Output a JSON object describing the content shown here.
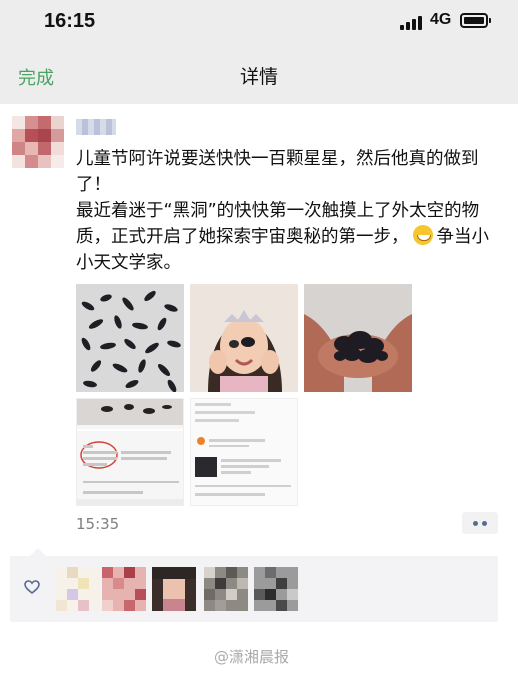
{
  "status_bar": {
    "time": "16:15",
    "network": "4G",
    "signal_icon": "signal-bars-icon",
    "battery_icon": "battery-icon"
  },
  "nav": {
    "done_label": "完成",
    "title": "详情"
  },
  "post": {
    "text_lines": [
      "儿童节阿许说要送快快一百颗星星，然后他真的做到了！",
      "最近着迷于“黑洞”的快快第一次触摸上了外太空的物质，正式开启了她探索宇宙奥秘的第一步，"
    ],
    "text_after_emoji": "争当小小天文学家。",
    "emoji_icon": "grinning-face-emoji",
    "time": "15:35",
    "more_icon": "more-dots-icon"
  },
  "likes": {
    "heart_icon": "heart-outline-icon",
    "liker_count": 5
  },
  "watermark": "@潇湘晨报",
  "colors": {
    "accent_green": "#4aa263",
    "link_blue": "#576b95",
    "background_gray": "#ededed"
  }
}
